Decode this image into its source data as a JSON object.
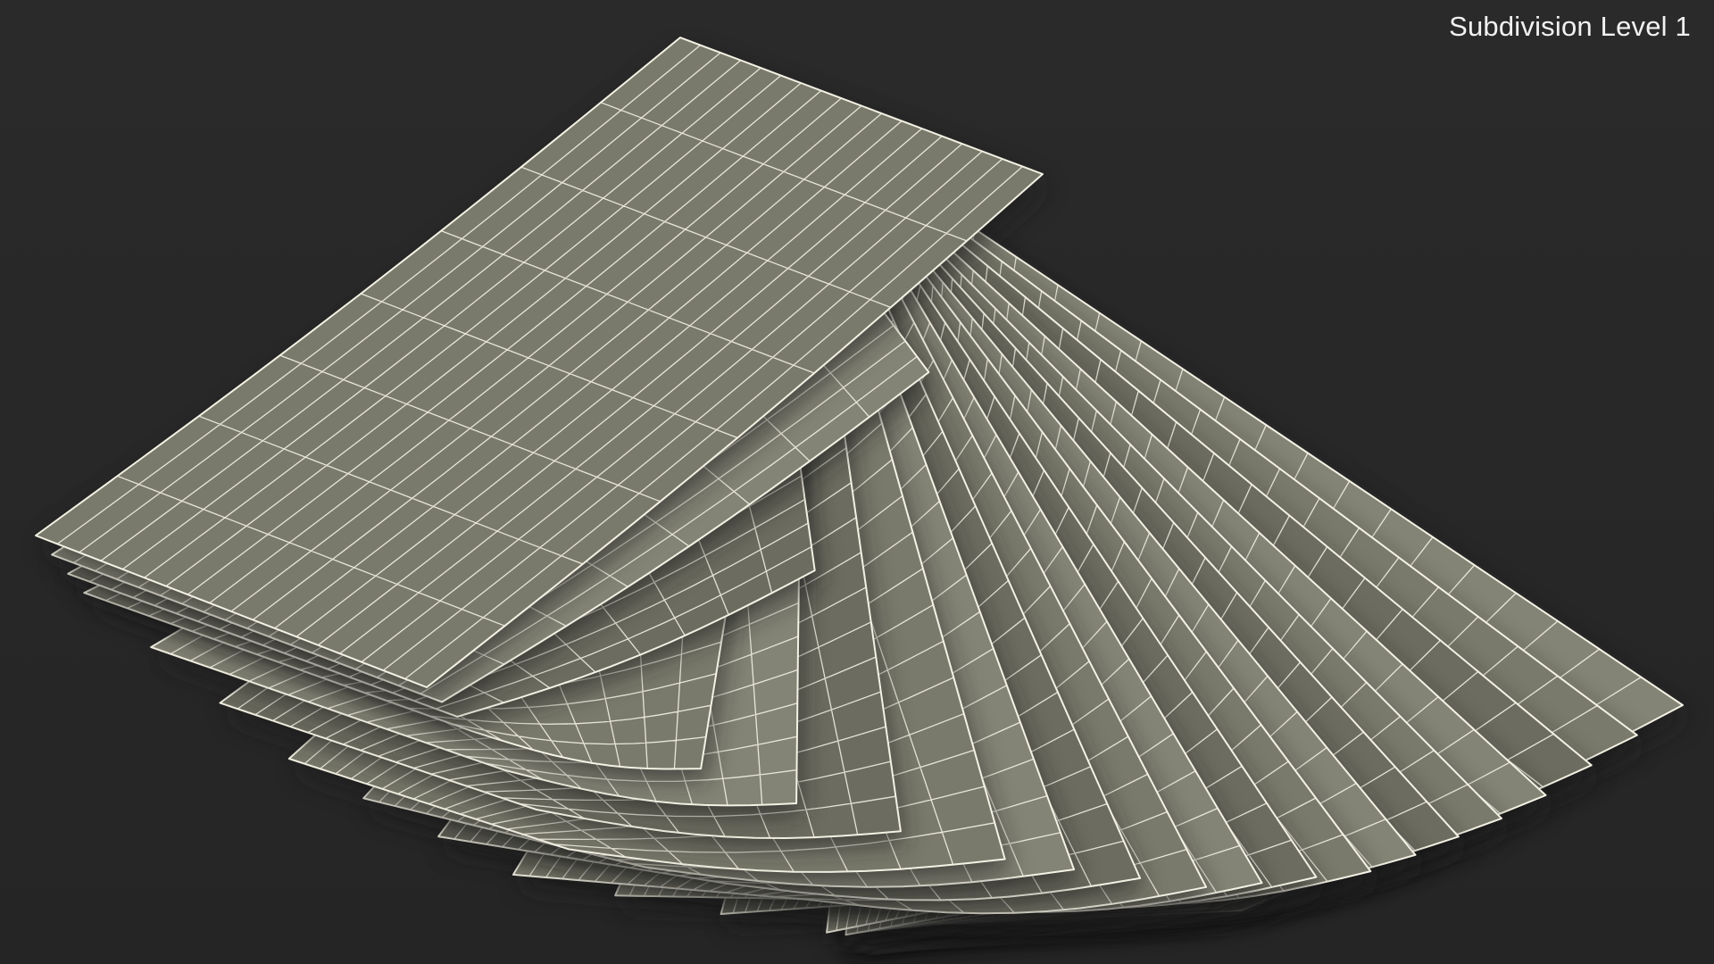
{
  "viewport": {
    "overlay_label": "Subdivision Level 1"
  },
  "scene": {
    "subject": "fanned stack of paper sheets",
    "sheet_count": 20,
    "grid_columns": 18,
    "grid_rows": 8,
    "colors": {
      "background": "#282828",
      "sheet_fill": "#7a7a6c",
      "sheet_fill_light": "#848476",
      "sheet_fill_dark": "#6c6c60",
      "wire": "#f4f2e4",
      "shadow": "#1e1e1e"
    }
  }
}
